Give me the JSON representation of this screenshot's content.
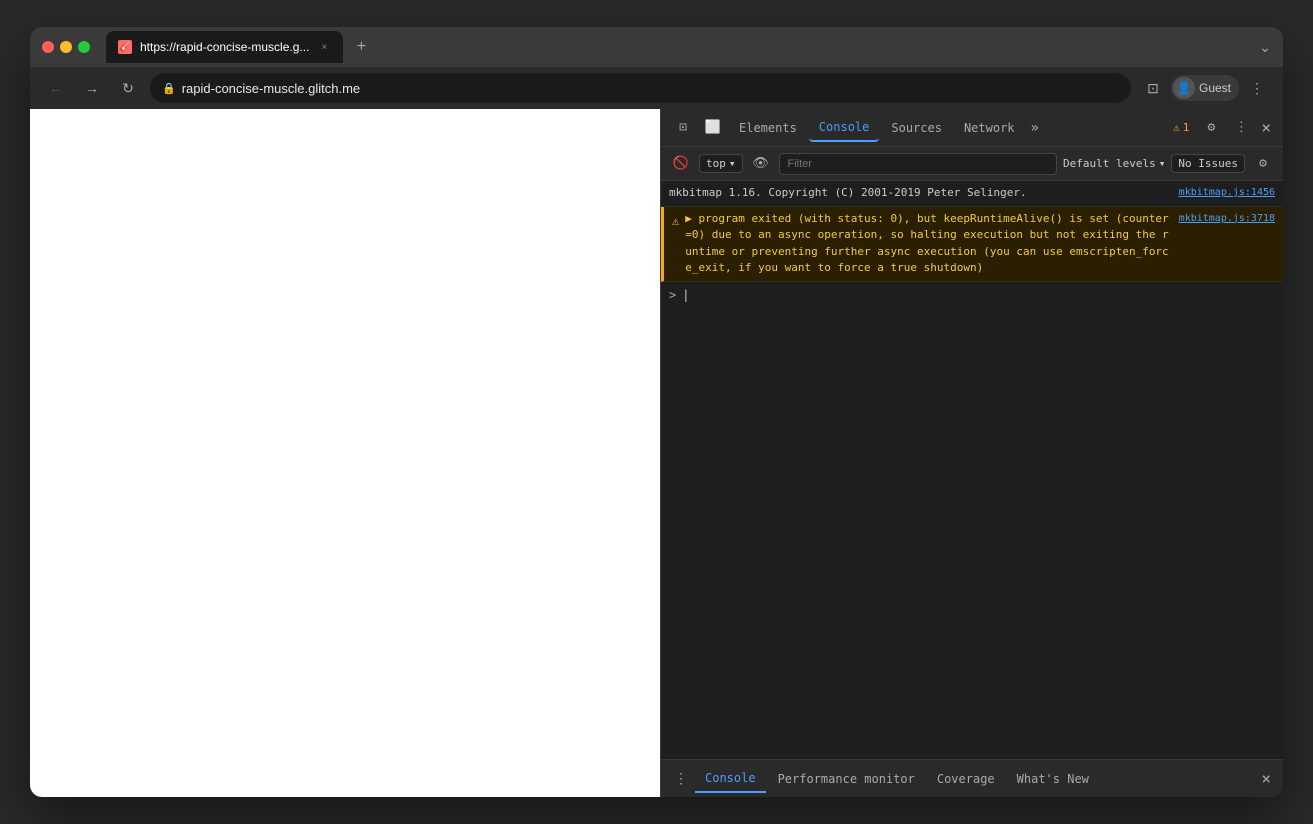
{
  "browser": {
    "tab": {
      "favicon": "🎸",
      "title": "https://rapid-concise-muscle.g...",
      "close": "×"
    },
    "tab_add": "+",
    "tab_chevron": "⌄",
    "nav": {
      "back": "←",
      "forward": "→",
      "reload": "↻",
      "address": "rapid-concise-muscle.glitch.me",
      "bookmark": "⊡",
      "profile_label": "Guest",
      "more": "⋮"
    }
  },
  "devtools": {
    "tabs": [
      {
        "label": "Elements",
        "active": false
      },
      {
        "label": "Console",
        "active": true
      },
      {
        "label": "Sources",
        "active": false
      },
      {
        "label": "Network",
        "active": false
      }
    ],
    "more": "»",
    "warning_count": "1",
    "settings_icon": "⚙",
    "more_icon": "⋮",
    "close_icon": "×",
    "select_element_icon": "⊡",
    "device_icon": "⬜",
    "console": {
      "toolbar": {
        "ban_icon": "🚫",
        "context": "top",
        "context_arrow": "▾",
        "eye_icon": "👁",
        "filter_placeholder": "Filter",
        "log_level": "Default levels",
        "log_level_arrow": "▾",
        "no_issues": "No Issues",
        "settings_icon": "⚙"
      },
      "messages": [
        {
          "type": "info",
          "text": "mkbitmap 1.16. Copyright (C) 2001-2019 Peter Selinger.",
          "link": "mkbitmap.js:1456",
          "icon": ""
        },
        {
          "type": "warning",
          "icon": "⚠",
          "text": "▶ program exited (with status: 0), but keepRuntimeAlive() is   set (counter=0) due to an async operation, so halting execution but not   exiting the runtime or preventing further async execution (you can use   emscripten_force_exit, if you want to force a true shutdown)",
          "link": "mkbitmap.js:3718"
        }
      ],
      "input_prompt": ">",
      "input_text": ""
    },
    "drawer": {
      "menu_icon": "⋮",
      "tabs": [
        {
          "label": "Console",
          "active": true
        },
        {
          "label": "Performance monitor",
          "active": false
        },
        {
          "label": "Coverage",
          "active": false
        },
        {
          "label": "What's New",
          "active": false
        }
      ],
      "close_icon": "×"
    }
  }
}
